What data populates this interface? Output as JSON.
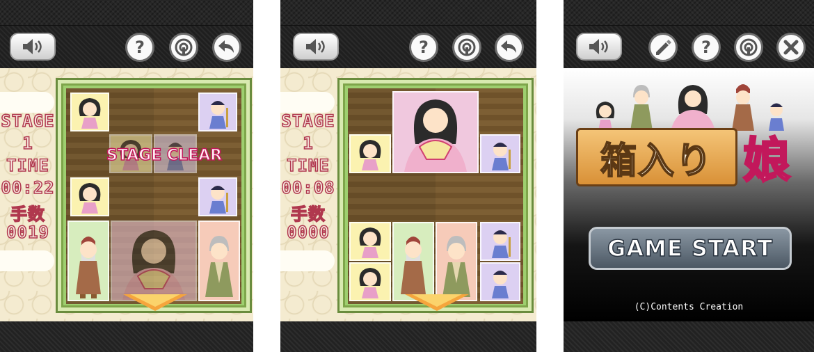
{
  "screens": [
    {
      "stage_label": "STAGE",
      "stage_value": "1",
      "time_label": "TIME",
      "time_value": "00:22",
      "moves_label": "手数",
      "moves_value": "0019",
      "overlay_text": "STAGE CLEAR"
    },
    {
      "stage_label": "STAGE",
      "stage_value": "1",
      "time_label": "TIME",
      "time_value": "00:08",
      "moves_label": "手数",
      "moves_value": "0000"
    },
    {
      "title_main": "箱入り",
      "title_hime": "娘",
      "start_label": "GAME START",
      "copyright": "(C)Contents Creation"
    }
  ],
  "icons": {
    "sound": "speaker-icon",
    "help": "question-icon",
    "ranking": "crest-icon",
    "back": "undo-arrow-icon",
    "edit": "pencil-icon",
    "close": "close-icon"
  },
  "colors": {
    "text_stroke": "#b0384e",
    "clear_stroke": "#c2185b",
    "board_green": "#9ecf6f",
    "tile_yellow": "#fbf2b0",
    "tile_lavender": "#dcd0f2",
    "tile_pink": "#f0c8de"
  }
}
